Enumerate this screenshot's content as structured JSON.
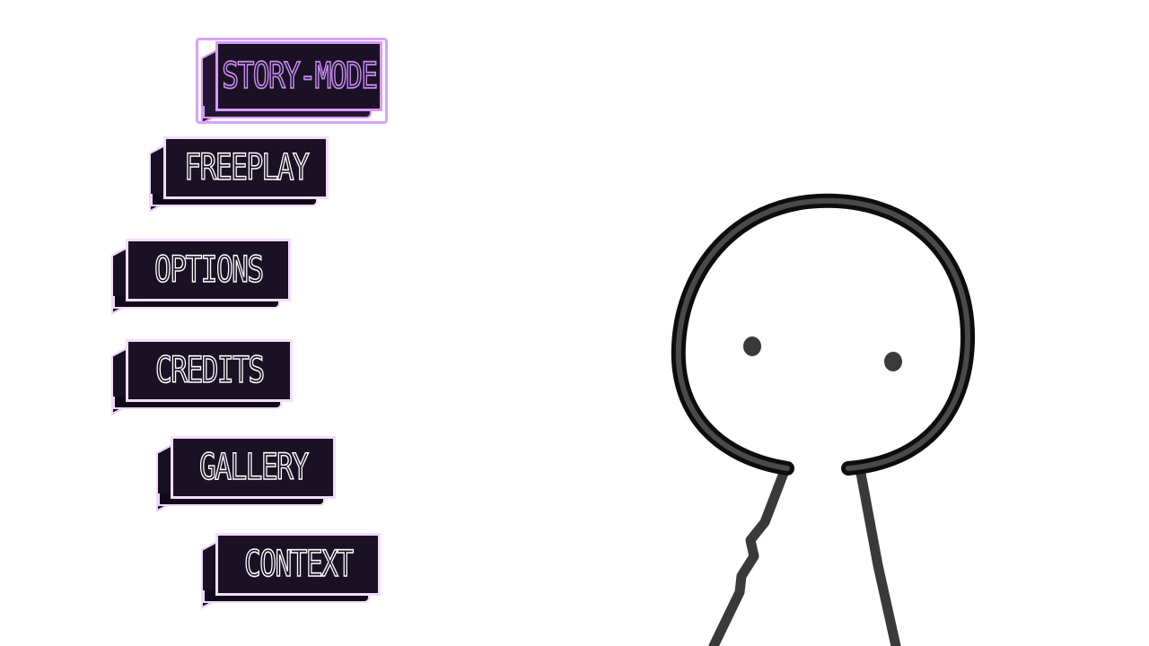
{
  "menu": {
    "selected_index": 0,
    "accent_color": "#d99af7",
    "items": [
      {
        "label": "STORY-MODE",
        "selected": true
      },
      {
        "label": "FREEPLAY",
        "selected": false
      },
      {
        "label": "OPTIONS",
        "selected": false
      },
      {
        "label": "CREDITS",
        "selected": false
      },
      {
        "label": "GALLERY",
        "selected": false
      },
      {
        "label": "CONTEXT",
        "selected": false
      }
    ]
  },
  "character": {
    "icon": "stick-figure-character",
    "outline_color": "#3a3a3a",
    "fill_color": "#ffffff"
  }
}
